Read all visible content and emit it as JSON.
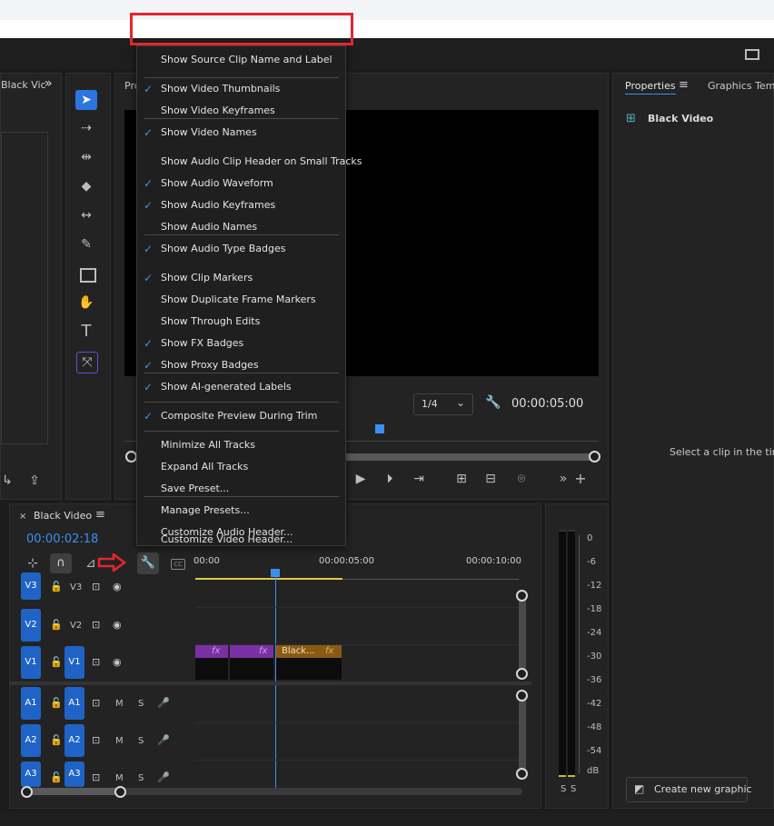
{
  "menu": {
    "items": [
      {
        "label": "Show Source Clip Name and Label",
        "checked": false
      },
      {
        "label": "Show Video Thumbnails",
        "checked": true
      },
      {
        "label": "Show Video Keyframes",
        "checked": false
      },
      {
        "label": "Show Video Names",
        "checked": true
      },
      {
        "label": "Show Audio Clip Header on Small Tracks",
        "checked": false
      },
      {
        "label": "Show Audio Waveform",
        "checked": true
      },
      {
        "label": "Show Audio Keyframes",
        "checked": true
      },
      {
        "label": "Show Audio Names",
        "checked": false
      },
      {
        "label": "Show Audio Type Badges",
        "checked": true
      },
      {
        "label": "Show Clip Markers",
        "checked": true
      },
      {
        "label": "Show Duplicate Frame Markers",
        "checked": false
      },
      {
        "label": "Show Through Edits",
        "checked": false
      },
      {
        "label": "Show FX Badges",
        "checked": true
      },
      {
        "label": "Show Proxy Badges",
        "checked": true
      },
      {
        "label": "Show AI-generated Labels",
        "checked": true
      },
      {
        "label": "Composite Preview During Trim",
        "checked": true
      },
      {
        "label": "Minimize All Tracks",
        "checked": false
      },
      {
        "label": "Expand All Tracks",
        "checked": false
      },
      {
        "label": "Save Preset...",
        "checked": false
      },
      {
        "label": "Manage Presets...",
        "checked": false
      },
      {
        "label": "Customize Video Header...",
        "checked": false
      },
      {
        "label": "Customize Audio Header...",
        "checked": false
      }
    ],
    "check_glyph": "✓"
  },
  "source_panel": {
    "tab": "Black Vic",
    "more": "»"
  },
  "program": {
    "tab": "Pro",
    "fraction": "1/4",
    "timecode": "00:00:05:00"
  },
  "properties": {
    "tab": "Properties",
    "tab2": "Graphics Temp",
    "clip_name": "Black Video",
    "hint": "Select a clip in the timel",
    "create_button": "Create new graphic"
  },
  "timeline": {
    "tab": "Black Video",
    "timecode": "00:00:02:18",
    "ruler": [
      "00:00",
      "00:00:05:00",
      "00:00:10:00"
    ],
    "video_tracks": [
      {
        "id": "V3",
        "target": "V3",
        "targeted": false
      },
      {
        "id": "V2",
        "target": "V2",
        "targeted": false
      },
      {
        "id": "V1",
        "target": "V1",
        "targeted": true
      }
    ],
    "audio_tracks": [
      {
        "id": "A1",
        "target": "A1",
        "m": "M",
        "s": "S"
      },
      {
        "id": "A2",
        "target": "A2",
        "m": "M",
        "s": "S"
      },
      {
        "id": "A3",
        "target": "A3",
        "m": "M",
        "s": "S"
      }
    ],
    "clips": [
      {
        "label": "fx",
        "color": "#7b2fa5"
      },
      {
        "label": "fx",
        "color": "#7b2fa5"
      },
      {
        "label": "Black...",
        "fx": "fx",
        "color": "#8a5a12"
      }
    ]
  },
  "meter": {
    "ticks": [
      "0",
      "-6",
      "-12",
      "-18",
      "-24",
      "-30",
      "-36",
      "-42",
      "-48",
      "-54",
      "dB"
    ],
    "solo": [
      "S",
      "S"
    ]
  },
  "colors": {
    "accent": "#3b8ff0",
    "highlight": "#e3262d",
    "track_blue": "#1f63c6"
  }
}
